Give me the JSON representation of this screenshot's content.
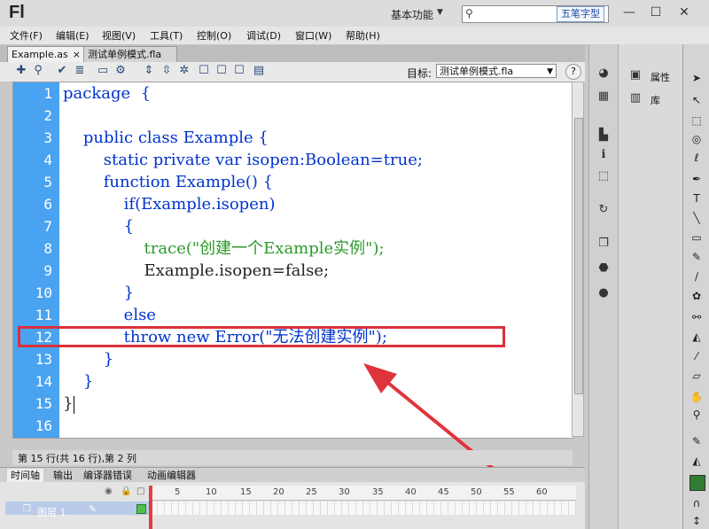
{
  "app": {
    "logo": "Fl",
    "workspace": "基本功能",
    "ime": "五笔字型"
  },
  "menu": [
    "文件(F)",
    "编辑(E)",
    "视图(V)",
    "工具(T)",
    "控制(O)",
    "调试(D)",
    "窗口(W)",
    "帮助(H)"
  ],
  "tabs": [
    {
      "label": "Example.as",
      "close": "×"
    },
    {
      "label": "测试单例模式.fla"
    }
  ],
  "toolbar": {
    "target_label": "目标:",
    "target_value": "测试单例模式.fla",
    "help": "?"
  },
  "editor": {
    "line_numbers": [
      "1",
      "2",
      "3",
      "4",
      "5",
      "6",
      "7",
      "8",
      "9",
      "10",
      "11",
      "12",
      "13",
      "14",
      "15",
      "16"
    ],
    "lines": [
      "package  {",
      "",
      "    public class Example {",
      "        static private var isopen:Boolean=true;",
      "        function Example() {",
      "            if(Example.isopen)",
      "            {",
      "                trace(\"创建一个Example实例\");",
      "                Example.isopen=false;",
      "            }",
      "            else",
      "            throw new Error(\"无法创建实例\");",
      "        }",
      "    }",
      "}",
      ""
    ]
  },
  "status": "第 15 行(共 16 行),第 2 列",
  "bottom_tabs": [
    "时间轴",
    "输出",
    "编译器错误",
    "动画编辑器"
  ],
  "timeline": {
    "frame_numbers": [
      "5",
      "10",
      "15",
      "20",
      "25",
      "30",
      "35",
      "40",
      "45",
      "50",
      "55",
      "60"
    ],
    "layer": "图层 1"
  },
  "panels": {
    "properties": "属性",
    "library": "库"
  },
  "colors": {
    "highlight": "#d9313a",
    "gutter": "#4aa3f0",
    "keyword": "#0033cc",
    "string": "#2b9a2b"
  }
}
